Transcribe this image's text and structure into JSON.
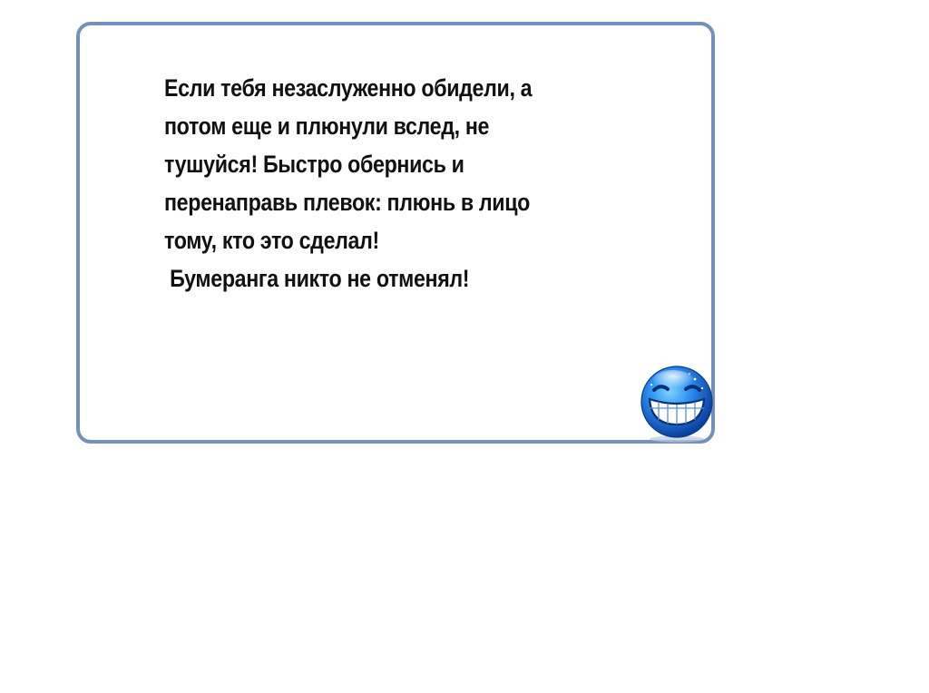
{
  "card": {
    "border_color": "#7591bb",
    "text_lines": [
      "Если тебя незаслуженно обидели, а",
      "потом еще и плюнули вслед, не",
      "тушуйся! Быстро обернись и",
      "перенаправь плевок: плюнь в лицо",
      "тому, кто это сделал!",
      " Бумеранга никто не отменял!"
    ]
  },
  "smiley": {
    "icon": "grinning-blue-smiley-icon",
    "face_color": "#1f7ee0"
  }
}
